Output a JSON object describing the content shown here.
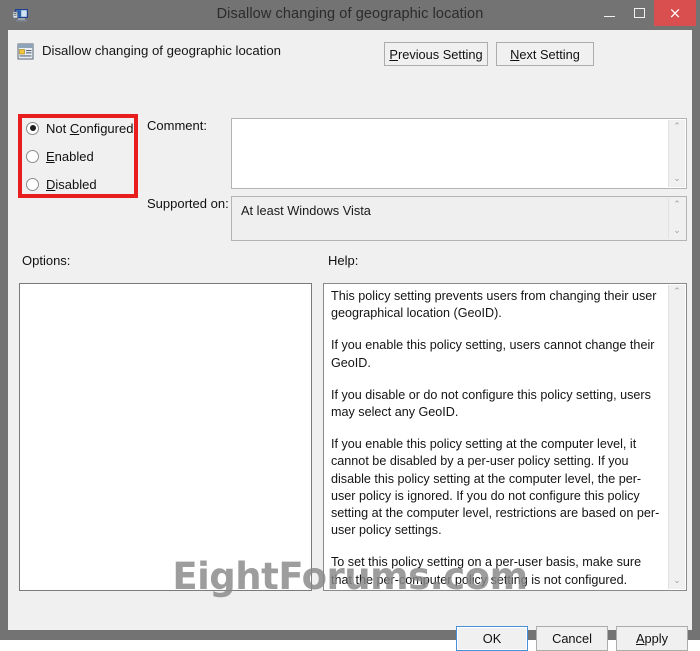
{
  "window": {
    "title": "Disallow changing of geographic location",
    "icon": "computer-policy-icon",
    "controls": {
      "minimize": "minimize-icon",
      "maximize": "maximize-icon",
      "close": "×"
    }
  },
  "header": {
    "icon": "policy-setting-icon",
    "title": "Disallow changing of geographic location",
    "previous_setting": {
      "pre": "",
      "acc": "P",
      "post": "revious Setting"
    },
    "next_setting": {
      "pre": "",
      "acc": "N",
      "post": "ext Setting"
    }
  },
  "state": {
    "options": [
      {
        "id": "not-configured",
        "pre": "Not ",
        "acc": "C",
        "post": "onfigured",
        "selected": true
      },
      {
        "id": "enabled",
        "pre": "",
        "acc": "E",
        "post": "nabled",
        "selected": false
      },
      {
        "id": "disabled",
        "pre": "",
        "acc": "D",
        "post": "isabled",
        "selected": false
      }
    ],
    "annotation_color": "#e81d1d"
  },
  "comment": {
    "label": "Comment:",
    "value": "",
    "scroll_up": "⌃",
    "scroll_down": "⌄"
  },
  "supported": {
    "label": "Supported on:",
    "value": "At least Windows Vista",
    "scroll_up": "⌃",
    "scroll_down": "⌄"
  },
  "panes": {
    "options_label": "Options:",
    "help_label": "Help:",
    "options_content": "",
    "help_paragraphs": [
      "This policy setting prevents users from changing their user geographical location (GeoID).",
      "If you enable this policy setting, users cannot change their GeoID.",
      "If you disable or do not configure this policy setting, users may select any GeoID.",
      "If you enable this policy setting at the computer level, it cannot be disabled by a per-user policy setting. If you disable this policy setting at the computer level, the per-user policy is ignored. If you do not configure this policy setting at the computer level, restrictions are based on per-user policy settings.",
      "To set this policy setting on a per-user basis, make sure that the per-computer policy setting is not configured."
    ],
    "help_scroll_up": "⌃",
    "help_scroll_down": "⌄"
  },
  "footer": {
    "ok": "OK",
    "cancel": "Cancel",
    "apply": {
      "pre": "",
      "acc": "A",
      "post": "pply"
    }
  },
  "watermark": "EightForums.com"
}
